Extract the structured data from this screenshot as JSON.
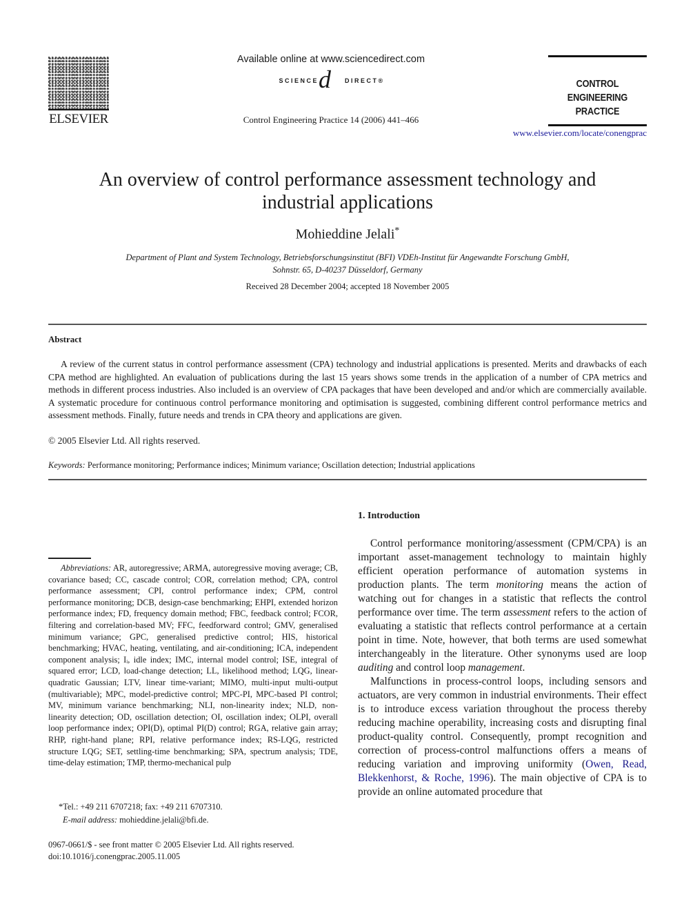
{
  "header": {
    "publisher_logo_text": "ELSEVIER",
    "available_online": "Available online at www.sciencedirect.com",
    "sciencedirect_left": "SCIENCE",
    "sciencedirect_at": "d",
    "sciencedirect_right": "DIRECT®",
    "journal_ref": "Control Engineering Practice 14 (2006) 441–466",
    "journal_title_line1": "CONTROL ENGINEERING",
    "journal_title_line2": "PRACTICE",
    "journal_url": "www.elsevier.com/locate/conengprac"
  },
  "article": {
    "title_line1": "An overview of control performance assessment technology and",
    "title_line2": "industrial applications",
    "author": "Mohieddine Jelali",
    "author_mark": "*",
    "affiliation_line1": "Department of Plant and System Technology, Betriebsforschungsinstitut (BFI) VDEh-Institut für Angewandte Forschung GmbH,",
    "affiliation_line2": "Sohnstr. 65, D-40237 Düsseldorf, Germany",
    "received": "Received 28 December 2004; accepted 18 November 2005"
  },
  "abstract": {
    "heading": "Abstract",
    "text": "A review of the current status in control performance assessment (CPA) technology and industrial applications is presented. Merits and drawbacks of each CPA method are highlighted. An evaluation of publications during the last 15 years shows some trends in the application of a number of CPA metrics and methods in different process industries. Also included is an overview of CPA packages that have been developed and and/or which are commercially available. A systematic procedure for continuous control performance monitoring and optimisation is suggested, combining different control performance metrics and assessment methods. Finally, future needs and trends in CPA theory and applications are given.",
    "copyright": "© 2005 Elsevier Ltd. All rights reserved.",
    "keywords_label": "Keywords:",
    "keywords": "Performance monitoring; Performance indices; Minimum variance; Oscillation detection; Industrial applications"
  },
  "footnotes": {
    "abbrev_label": "Abbreviations:",
    "abbrev_text": "AR, autoregressive; ARMA, autoregressive moving average; CB, covariance based; CC, cascade control; COR, correlation method; CPA, control performance assessment; CPI, control performance index; CPM, control performance monitoring; DCB, design-case benchmarking; EHPI, extended horizon performance index; FD, frequency domain method; FBC, feedback control; FCOR, filtering and correlation-based MV; FFC, feedforward control; GMV, generalised minimum variance; GPC, generalised predictive control; HIS, historical benchmarking; HVAC, heating, ventilating, and air-conditioning; ICA, independent component analysis; Iᵢ, idle index; IMC, internal model control; ISE, integral of squared error; LCD, load-change detection; LL, likelihood method; LQG, linear-quadratic Gaussian; LTV, linear time-variant; MIMO, multi-input multi-output (multivariable); MPC, model-predictive control; MPC-PI, MPC-based PI control; MV, minimum variance benchmarking; NLI, non-linearity index; NLD, non-linearity detection; OD, oscillation detection; OI, oscillation index; OLPI, overall loop performance index; OPI(D), optimal PI(D) control; RGA, relative gain array; RHP, right-hand plane; RPI, relative performance index; RS-LQG, restricted structure LQG; SET, settling-time benchmarking; SPA, spectrum analysis; TDE, time-delay estimation; TMP, thermo-mechanical pulp",
    "tel": "*Tel.: +49 211 6707218; fax: +49 211 6707310.",
    "email_label": "E-mail address:",
    "email": "mohieddine.jelali@bfi.de.",
    "front_matter": "0967-0661/$ - see front matter © 2005 Elsevier Ltd. All rights reserved.",
    "doi": "doi:10.1016/j.conengprac.2005.11.005"
  },
  "introduction": {
    "heading": "1.  Introduction",
    "p1_a": "Control performance monitoring/assessment (CPM/CPA) is an important asset-management technology to maintain highly efficient operation performance of automation systems in production plants. The term ",
    "p1_i1": "monitoring",
    "p1_b": " means the action of watching out for changes in a statistic that reflects the control performance over time. The term ",
    "p1_i2": "assessment",
    "p1_c": " refers to the action of evaluating a statistic that reflects control performance at a certain point in time. Note, however, that both terms are used somewhat interchangeably in the literature. Other synonyms used are loop ",
    "p1_i3": "auditing",
    "p1_d": " and control loop ",
    "p1_i4": "management",
    "p1_e": ".",
    "p2_a": "Malfunctions in process-control loops, including sensors and actuators, are very common in industrial environments. Their effect is to introduce excess variation throughout the process thereby reducing machine operability, increasing costs and disrupting final product-quality control. Consequently, prompt recognition and correction of process-control malfunctions offers a means of reducing variation and improving uniformity (",
    "p2_cite": "Owen, Read, Blekkenhorst, & Roche, 1996",
    "p2_b": "). The main objective of CPA is to provide an online automated procedure that"
  },
  "colors": {
    "link": "#1a1a8a",
    "rule": "#555555"
  }
}
